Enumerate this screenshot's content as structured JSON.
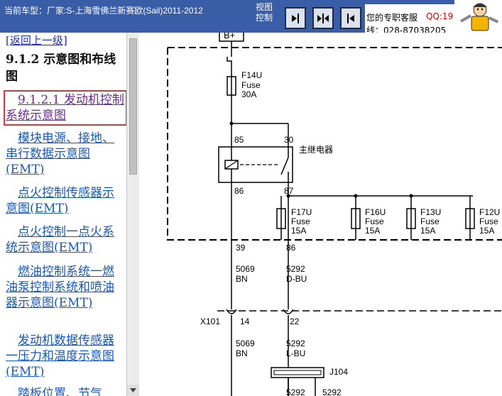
{
  "header": {
    "vehicle_label": "当前车型：厂家:S-上海雪佛兰新赛欧(Sail)2011-2012",
    "view_control_label": "视图控制",
    "advisor_label": "您的专职客服",
    "qq_label": "QQ:19",
    "phone_label": "线：028-87038205",
    "buttons": [
      {
        "icon": "arrow-right-bar-icon"
      },
      {
        "icon": "arrows-inward-icon"
      },
      {
        "icon": "arrow-left-bar-icon"
      }
    ],
    "mascot_icon": "mechanic-mascot-icon",
    "colors": {
      "bar": "#3a5da8",
      "qq": "#d40000"
    }
  },
  "sidebar": {
    "back_link": "[返回上一级]",
    "section_title": "9.1.2 示意图和布线图",
    "items": [
      {
        "label": "9.1.2.1 发动机控制系统示意图",
        "active": true
      },
      {
        "label": "模块电源、接地、串行数据示意图(EMT)"
      },
      {
        "label": "点火控制传感器示意图(EMT)"
      },
      {
        "label": "点火控制一点火系统示意图(EMT)"
      },
      {
        "label": "燃油控制系统一燃油泵控制系统和喷油器示意图(EMT)"
      },
      {
        "label": "发动机数据传感器一压力和温度示意图(EMT)"
      },
      {
        "label": "踏板位置、节气"
      }
    ]
  },
  "diagram": {
    "battery": "B+",
    "main_fuse": {
      "id": "F14U",
      "type": "Fuse",
      "rating": "30A"
    },
    "relay": {
      "pins": [
        "85",
        "30",
        "86",
        "87"
      ],
      "label": "主继电器"
    },
    "fuses": [
      {
        "id": "F17U",
        "type": "Fuse",
        "rating": "15A"
      },
      {
        "id": "F16U",
        "type": "Fuse",
        "rating": "15A"
      },
      {
        "id": "F13U",
        "type": "Fuse",
        "rating": "15A"
      },
      {
        "id": "F12U",
        "type": "Fuse",
        "rating": "15A"
      }
    ],
    "pins_out": [
      "39",
      "86"
    ],
    "wires_a": [
      {
        "circuit": "5069",
        "color": "BN"
      },
      {
        "circuit": "5292",
        "color": "D-BU"
      }
    ],
    "connector": {
      "id": "X101",
      "pins": [
        "14",
        "22"
      ]
    },
    "wires_b": [
      {
        "circuit": "5069",
        "color": "BN"
      },
      {
        "circuit": "5292",
        "color": "L-BU"
      }
    ],
    "splice": {
      "id": "J104",
      "circuits": [
        "5292",
        "5292"
      ]
    }
  }
}
